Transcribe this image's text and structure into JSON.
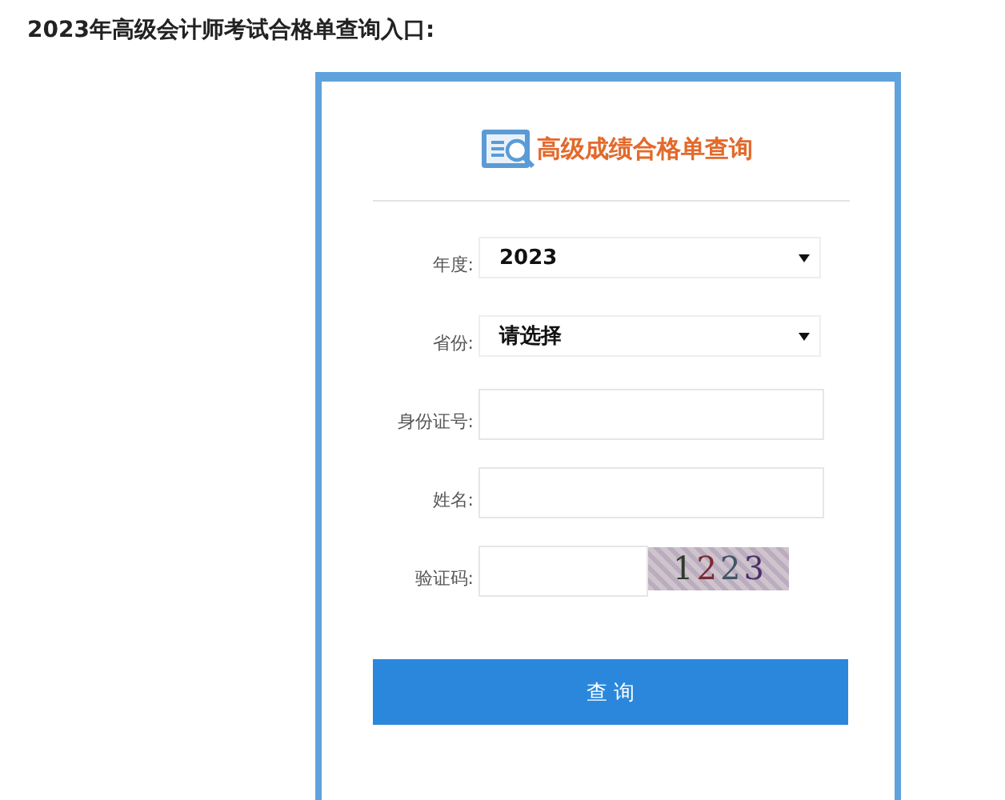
{
  "heading": "2023年高级会计师考试合格单查询入口:",
  "card": {
    "title": "高级成绩合格单查询"
  },
  "fields": [
    {
      "kind": "select",
      "label": "年度:",
      "value": "2023"
    },
    {
      "kind": "select",
      "label": "省份:",
      "value": "请选择"
    },
    {
      "kind": "text",
      "label": "身份证号:"
    },
    {
      "kind": "text",
      "label": "姓名:"
    },
    {
      "kind": "captcha",
      "label": "验证码:",
      "code": "1223"
    }
  ],
  "button": "查 询"
}
